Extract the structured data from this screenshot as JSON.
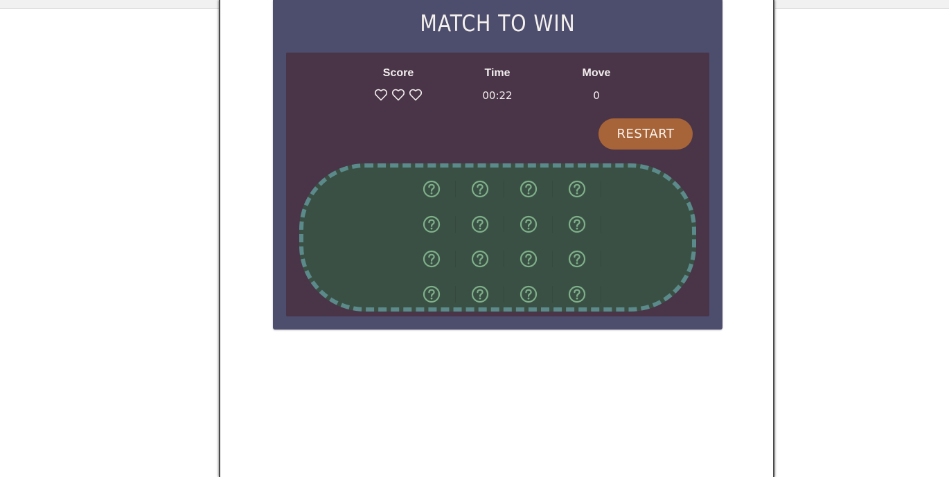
{
  "game": {
    "title": "MATCH TO WIN",
    "stats": {
      "score_label": "Score",
      "lives": 3,
      "time_label": "Time",
      "time_value": "00:22",
      "move_label": "Move",
      "move_value": "0"
    },
    "restart_label": "RESTART",
    "deck": {
      "rows": 4,
      "cols": 4,
      "card_icon": "question-icon",
      "cards_face_down": 16
    },
    "colors": {
      "container": "#4d4d6e",
      "panel": "#4a3447",
      "deck_background": "#3a5044",
      "deck_border": "#5b8a8a",
      "card_icon": "#7fb08a",
      "restart_button": "#a76438",
      "text": "#f2eeee"
    }
  }
}
